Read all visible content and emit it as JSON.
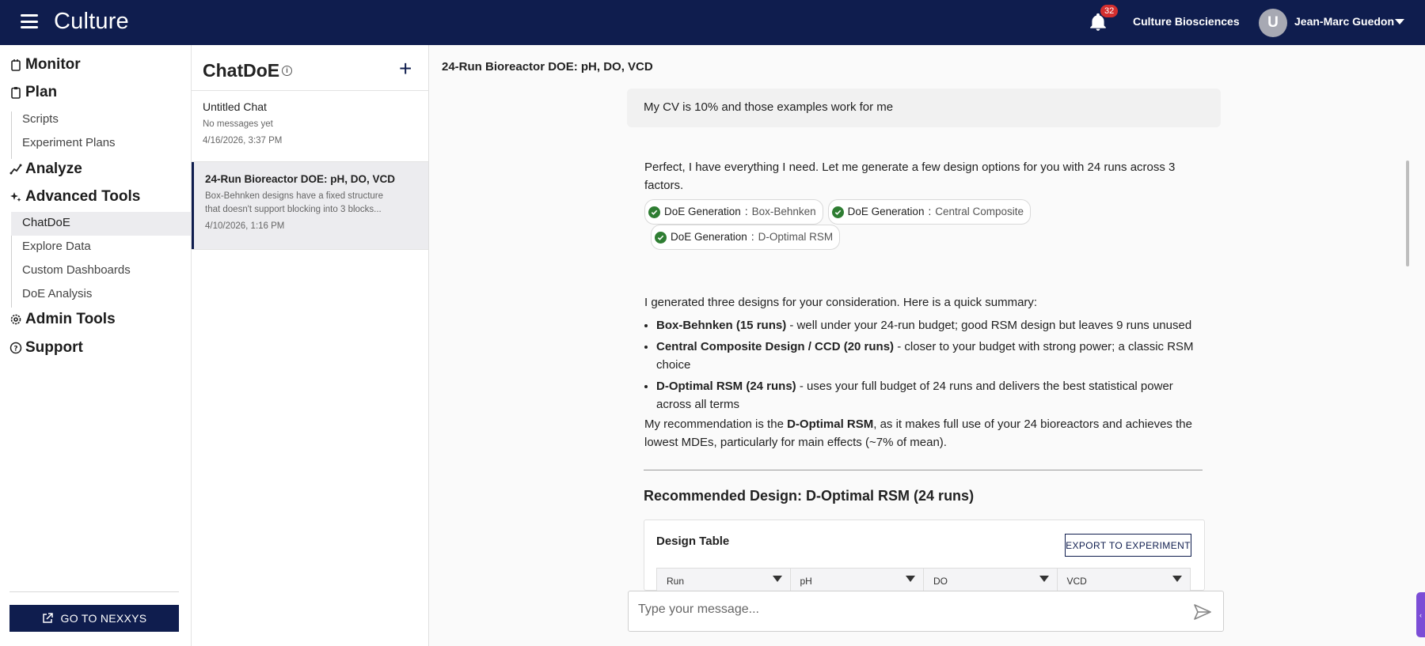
{
  "header": {
    "logo": "Culture",
    "notification_count": "32",
    "org_name": "Culture Biosciences",
    "avatar_initial": "U",
    "user_name": "Jean-Marc Guedon"
  },
  "nav": {
    "sections": {
      "monitor": "Monitor",
      "plan": "Plan",
      "analyze": "Analyze",
      "advanced": "Advanced Tools",
      "admin": "Admin Tools",
      "support": "Support"
    },
    "plan_items": [
      "Scripts",
      "Experiment Plans"
    ],
    "advanced_items": [
      "ChatDoE",
      "Explore Data",
      "Custom Dashboards",
      "DoE Analysis"
    ],
    "goto_label": "GO TO NEXXYS"
  },
  "chatlist": {
    "title": "ChatDoE",
    "items": [
      {
        "title": "Untitled Chat",
        "subtitle": "No messages yet",
        "date": "4/16/2026, 3:37 PM"
      },
      {
        "title": "24-Run Bioreactor DOE: pH, DO, VCD",
        "subtitle": "Box-Behnken designs have a fixed structure that doesn't support blocking into 3 blocks...",
        "date": "4/10/2026, 1:16 PM"
      }
    ]
  },
  "main": {
    "title": "24-Run Bioreactor DOE: pH, DO, VCD",
    "user_message": "My CV is 10% and those examples work for me",
    "ai_intro": "Perfect, I have everything I need. Let me generate a few design options for you with 24 runs across 3 factors.",
    "tools": [
      {
        "label": "DoE Generation",
        "value": "Box-Behnken"
      },
      {
        "label": "DoE Generation",
        "value": "Central Composite"
      },
      {
        "label": "DoE Generation",
        "value": "D-Optimal RSM"
      }
    ],
    "summary_intro": "I generated three designs for your consideration. Here is a quick summary:",
    "bullets": [
      {
        "bold": "Box-Behnken (15 runs)",
        "text": " - well under your 24-run budget; good RSM design but leaves 9 runs unused"
      },
      {
        "bold": "Central Composite Design / CCD (20 runs)",
        "text": " - closer to your budget with strong power; a classic RSM choice"
      },
      {
        "bold": "D-Optimal RSM (24 runs)",
        "text": " - uses your full budget of 24 runs and delivers the best statistical power across all terms"
      }
    ],
    "rec_pre": "My recommendation is the ",
    "rec_bold": "D-Optimal RSM",
    "rec_post": ", as it makes full use of your 24 bioreactors and achieves the lowest MDEs, particularly for main effects (~7% of mean).",
    "rec_heading": "Recommended Design: D-Optimal RSM (24 runs)",
    "table": {
      "title": "Design Table",
      "export_label": "EXPORT TO EXPERIMENT",
      "columns": [
        "Run",
        "pH",
        "DO",
        "VCD"
      ]
    },
    "input_placeholder": "Type your message..."
  }
}
